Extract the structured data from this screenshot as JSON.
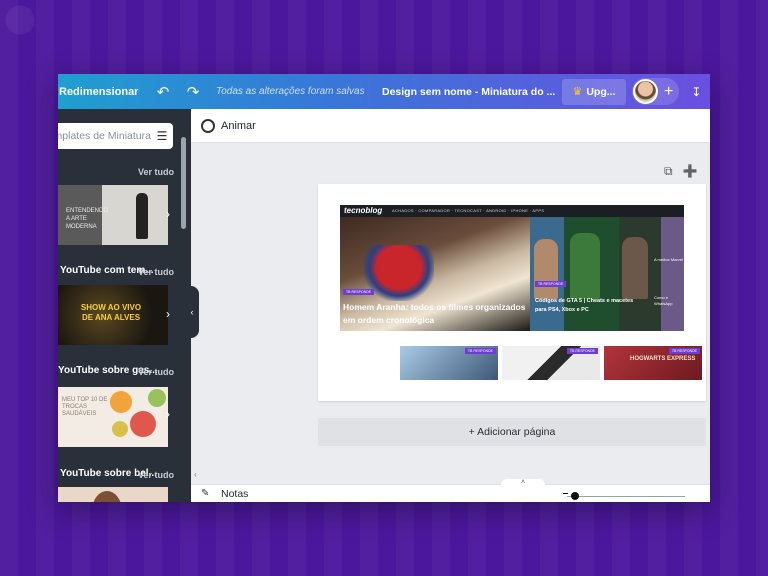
{
  "colors": {
    "background": "#4b179c",
    "topbar_start": "#1f9fcf",
    "topbar_end": "#6b4fe0",
    "sidebar": "#293039",
    "accent": "#6f3dd1",
    "crown": "#ffc42e"
  },
  "topbar": {
    "resize_label": "Redimensionar",
    "undo_icon": "undo-icon",
    "redo_icon": "redo-icon",
    "saved_status": "Todas as alterações foram salvas",
    "document_title": "Design sem nome - Miniatura do ...",
    "upgrade_label": "Upg...",
    "add_collaborator_icon": "plus-icon"
  },
  "sidebar": {
    "search_placeholder": "Pesquisar templates de Miniatura",
    "sections": [
      {
        "title": "",
        "see_all": "Ver tudo",
        "thumb_text": "ENTENDENDO A ARTE MODERNA"
      },
      {
        "title": "Miniatura do YouTube com tem...",
        "see_all": "Ver tudo",
        "thumb_text": "SHOW AO VIVO DE ANA ALVES"
      },
      {
        "title": "Miniatura do YouTube sobre gas...",
        "see_all": "Ver tudo",
        "thumb_text": "MEU TOP 10 DE TROCAS SAUDÁVEIS"
      },
      {
        "title": "Miniatura do YouTube sobre bel...",
        "see_all": "Ver tudo",
        "thumb_text": ""
      }
    ]
  },
  "toolbar": {
    "animate_label": "Animar"
  },
  "canvas": {
    "site_logo": "tecnoblog",
    "site_nav": "ACHADOS  ·  COMPARADOR  ·  TECNOCAST  ·  ANDROID  ·  IPHONE  ·  APPS",
    "hero_tag": "TB RESPONDE",
    "hero_title": "Homem Aranha: todos os filmes organizados em ordem cronológica",
    "gta_tag": "TB RESPONDE",
    "gta_title": "Códigos de GTA 5 | Cheats e macetes para PS4, Xbox e PC",
    "side_title_1": "A melhor Marvel",
    "side_title_2": "Como e WhatsApp",
    "small_tag": "TB RESPONDE",
    "small_word": "HOGWARTS EXPRESS",
    "add_page_label": "+ Adicionar página"
  },
  "bottom": {
    "notes_label": "Notas"
  }
}
